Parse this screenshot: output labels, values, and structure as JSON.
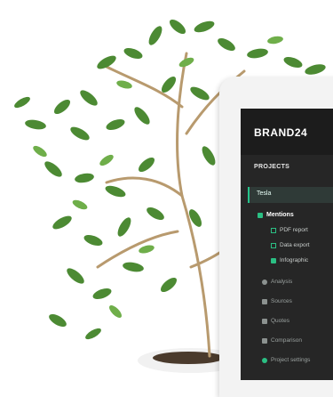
{
  "brand": {
    "logo_text": "BRAND24"
  },
  "sidebar": {
    "section_title": "PROJECTS",
    "active_project": "Tesla",
    "mentions_label": "Mentions",
    "sub_items": [
      {
        "label": "PDF report",
        "icon": "pdf-icon"
      },
      {
        "label": "Data export",
        "icon": "data-export-icon"
      },
      {
        "label": "Infographic",
        "icon": "infographic-icon"
      }
    ],
    "items": [
      {
        "label": "Analysis",
        "icon": "analysis-icon"
      },
      {
        "label": "Sources",
        "icon": "sources-icon"
      },
      {
        "label": "Quotes",
        "icon": "quotes-icon"
      },
      {
        "label": "Comparison",
        "icon": "comparison-icon"
      },
      {
        "label": "Project settings",
        "icon": "share-icon"
      }
    ]
  },
  "colors": {
    "sidebar_bg": "#262626",
    "accent_green": "#2bbf83",
    "text_light": "#e8e8e8"
  }
}
